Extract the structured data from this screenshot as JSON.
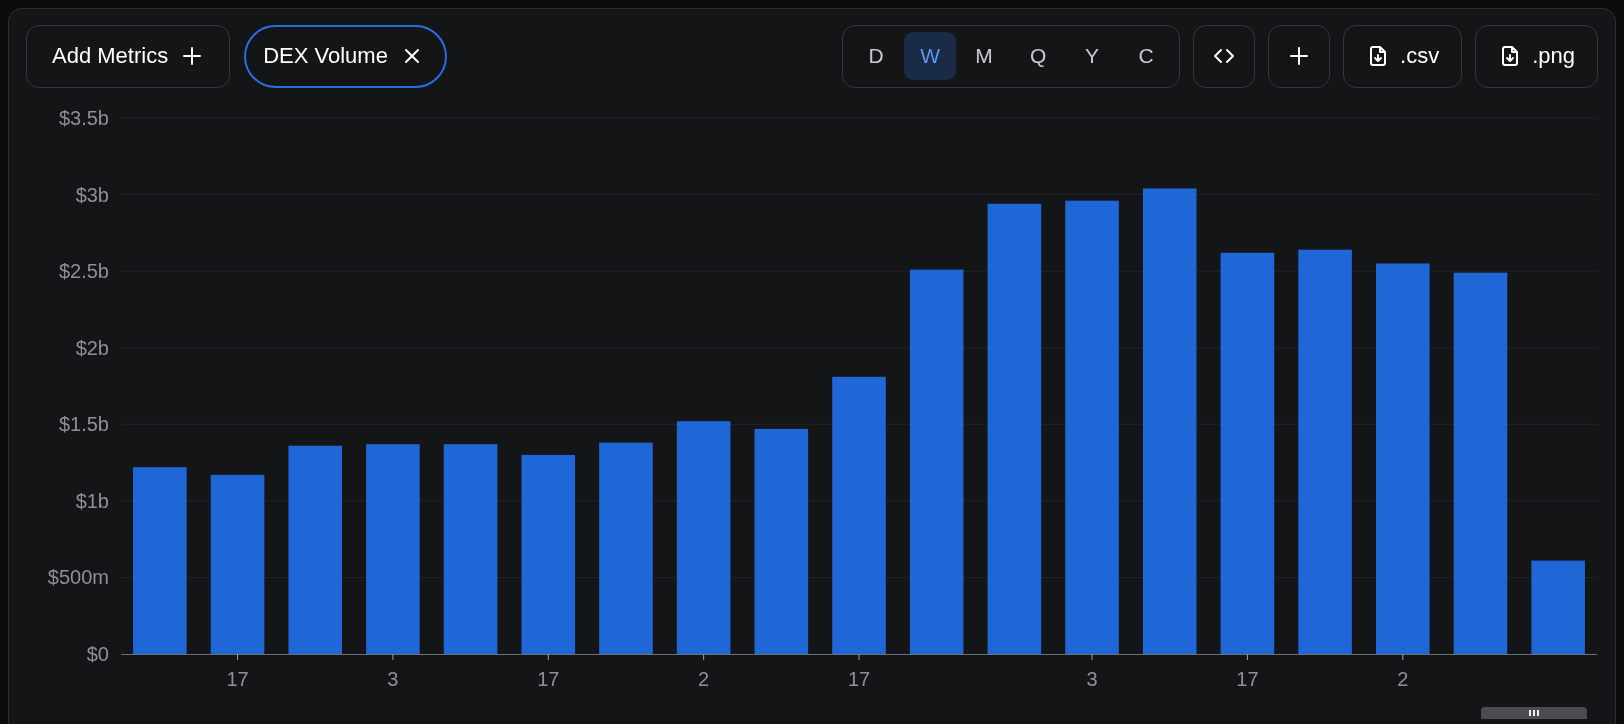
{
  "toolbar": {
    "add_metrics": "Add Metrics",
    "metric_chips": [
      {
        "label": "DEX Volume",
        "selected": true
      }
    ],
    "periods": [
      {
        "label": "D",
        "selected": false
      },
      {
        "label": "W",
        "selected": true
      },
      {
        "label": "M",
        "selected": false
      },
      {
        "label": "Q",
        "selected": false
      },
      {
        "label": "Y",
        "selected": false
      },
      {
        "label": "C",
        "selected": false
      }
    ],
    "downloads": [
      ".csv",
      ".png"
    ]
  },
  "chart": {
    "chart_data": {
      "type": "bar",
      "categories": [
        null,
        "17",
        null,
        "3",
        null,
        "17",
        null,
        "2",
        null,
        "17",
        null,
        null,
        "3",
        null,
        "17",
        null,
        "2",
        null,
        null
      ],
      "series": [
        {
          "color": "#1f66d6",
          "values": [
            1220000000,
            1170000000,
            1360000000,
            1370000000,
            1370000000,
            1300000000,
            1380000000,
            1520000000,
            1470000000,
            1810000000,
            2510000000,
            2940000000,
            2960000000,
            3040000000,
            2620000000,
            2640000000,
            2550000000,
            2490000000,
            610000000
          ]
        }
      ],
      "grid": true,
      "ylim": [
        0,
        3500000000
      ],
      "yticks": [
        {
          "value": 0,
          "label": "$0"
        },
        {
          "value": 500000000,
          "label": "$500m"
        },
        {
          "value": 1000000000,
          "label": "$1b"
        },
        {
          "value": 1500000000,
          "label": "$1.5b"
        },
        {
          "value": 2000000000,
          "label": "$2b"
        },
        {
          "value": 2500000000,
          "label": "$2.5b"
        },
        {
          "value": 3000000000,
          "label": "$3b"
        },
        {
          "value": 3500000000,
          "label": "$3.5b"
        }
      ]
    }
  }
}
